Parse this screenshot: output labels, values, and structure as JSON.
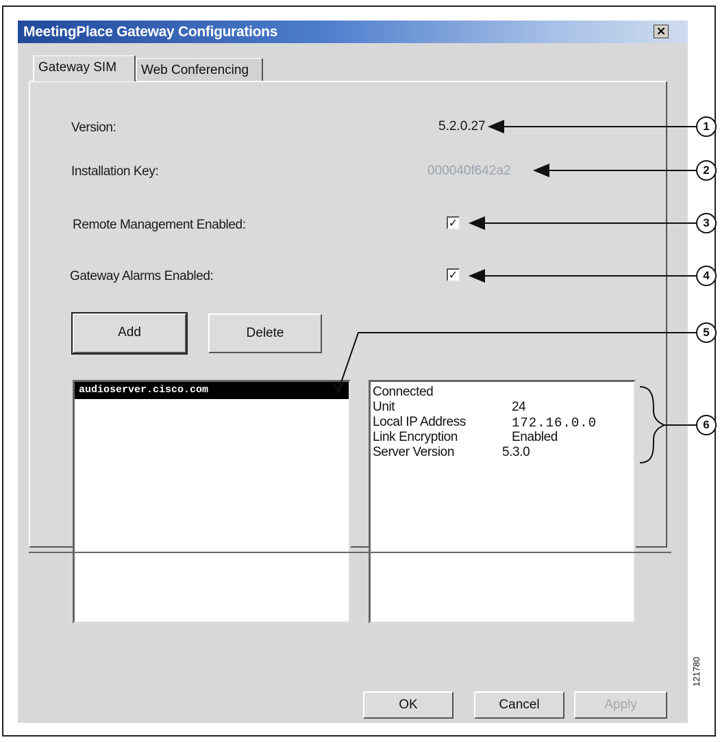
{
  "window": {
    "title": "MeetingPlace Gateway Configurations",
    "close_glyph": "×",
    "close_icon": "close-icon"
  },
  "tabs": [
    {
      "label": "Gateway SIM",
      "active": true
    },
    {
      "label": "Web Conferencing",
      "active": false
    }
  ],
  "fields": {
    "version_label": "Version:",
    "version_value": "5.2.0.27",
    "install_key_label": "Installation Key:",
    "install_key_value": "000040f642a2",
    "remote_mgmt_label": "Remote Management Enabled:",
    "remote_mgmt_checked": true,
    "alarms_label": "Gateway Alarms Enabled:",
    "alarms_checked": true
  },
  "buttons": {
    "add": "Add",
    "delete": "Delete",
    "ok": "OK",
    "cancel": "Cancel",
    "apply": "Apply"
  },
  "server_list": {
    "items": [
      "audioserver.cisco.com"
    ],
    "selected_index": 0
  },
  "server_info": {
    "status": "Connected",
    "rows": [
      {
        "label": "Unit",
        "value": "24"
      },
      {
        "label": "Local IP Address",
        "value": "172.16.0.0"
      },
      {
        "label": "Link Encryption",
        "value": "Enabled"
      },
      {
        "label": "Server Version",
        "value": "5.3.0"
      }
    ]
  },
  "callouts": [
    "1",
    "2",
    "3",
    "4",
    "5",
    "6"
  ],
  "figure_id": "121780",
  "colors": {
    "title_gradient_start": "#214a9c",
    "dialog_bg": "#d8d8d8",
    "disabled_text": "#9aa3ad",
    "selection_bg": "#000000"
  }
}
